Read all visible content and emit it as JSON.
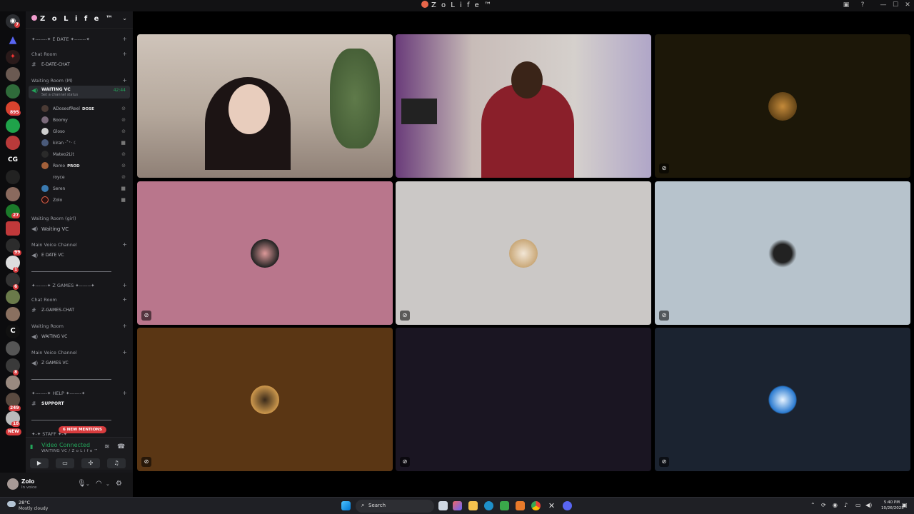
{
  "window": {
    "title": "Z o L i f e ™",
    "controls": [
      "—",
      "☐",
      "✕"
    ]
  },
  "server_rail": {
    "badges": [
      "7",
      "895",
      "27",
      "99",
      "1",
      "6",
      "8",
      "249",
      "18"
    ],
    "cg_label": "CG",
    "new_label": "NEW"
  },
  "sidebar": {
    "guild_name": "Z o L i f e ™",
    "sections": {
      "edate_divider": "✦-------✦ E DATE ✦-------✦",
      "chat_room": "Chat Room",
      "edate_chat": "E-DATE-CHAT",
      "waiting_room_m": "Waiting Room (M)",
      "waiting_vc": "WAITING VC",
      "channel_status": "Set a channel status",
      "timer": "42:44",
      "waiting_room_girl": "Waiting Room (girl)",
      "waiting_vc_2": "Waiting VC",
      "main_voice": "Main Voice Channel",
      "edate_vc": "E DATE VC",
      "zgames_divider": "✦-------✦ Z GAMES ✦-------✦",
      "chat_room_2": "Chat Room",
      "zgames_chat": "Z-GAMES-CHAT",
      "waiting_room": "Waiting Room",
      "waiting_vc_3": "WAITING VC",
      "main_voice_2": "Main Voice Channel",
      "zgames_vc": "Z GAMES VC",
      "help_divider": "✦-------✦ HELP ✦-------✦",
      "support": "SUPPORT",
      "staff_divider": "✦-✦ STAFF ✦-✦"
    },
    "members": [
      {
        "name": "ADoseofReel",
        "tag": "DOSE"
      },
      {
        "name": "Boomy",
        "tag": ""
      },
      {
        "name": "Gloso",
        "tag": ""
      },
      {
        "name": "kiran ·˚⁺‧ ☾",
        "tag": ""
      },
      {
        "name": "Mateo2Lit",
        "tag": ""
      },
      {
        "name": "Romo",
        "tag": "PROD"
      },
      {
        "name": "royce",
        "tag": ""
      },
      {
        "name": "Seren",
        "tag": ""
      },
      {
        "name": "Zolo",
        "tag": ""
      }
    ],
    "new_mentions": "6 NEW MENTIONS"
  },
  "voice_panel": {
    "status": "Video Connected",
    "location": "WAITING VC / Z o L i f e ™"
  },
  "user_panel": {
    "username": "Zolo",
    "status": "In voice"
  },
  "video_tiles": [
    {
      "type": "camera",
      "bg": "#b9aca1",
      "muted": false
    },
    {
      "type": "camera",
      "bg": "#7a6e6a",
      "muted": false
    },
    {
      "type": "avatar",
      "bg": "#1c1708",
      "muted": true
    },
    {
      "type": "avatar",
      "bg": "#b9768c",
      "muted": true
    },
    {
      "type": "avatar",
      "bg": "#cbc8c6",
      "muted": true
    },
    {
      "type": "avatar",
      "bg": "#b7c3cc",
      "muted": true
    },
    {
      "type": "avatar",
      "bg": "#5a3614",
      "muted": true
    },
    {
      "type": "empty",
      "bg": "#1a1522",
      "muted": true
    },
    {
      "type": "avatar",
      "bg": "#1b2330",
      "muted": true
    }
  ],
  "taskbar": {
    "weather_temp": "28°C",
    "weather_desc": "Mostly cloudy",
    "search_label": "Search",
    "time": "5:40 PM",
    "date": "10/26/2025"
  },
  "colors": {
    "accent_green": "#23a55a",
    "danger_red": "#d83c3e"
  }
}
